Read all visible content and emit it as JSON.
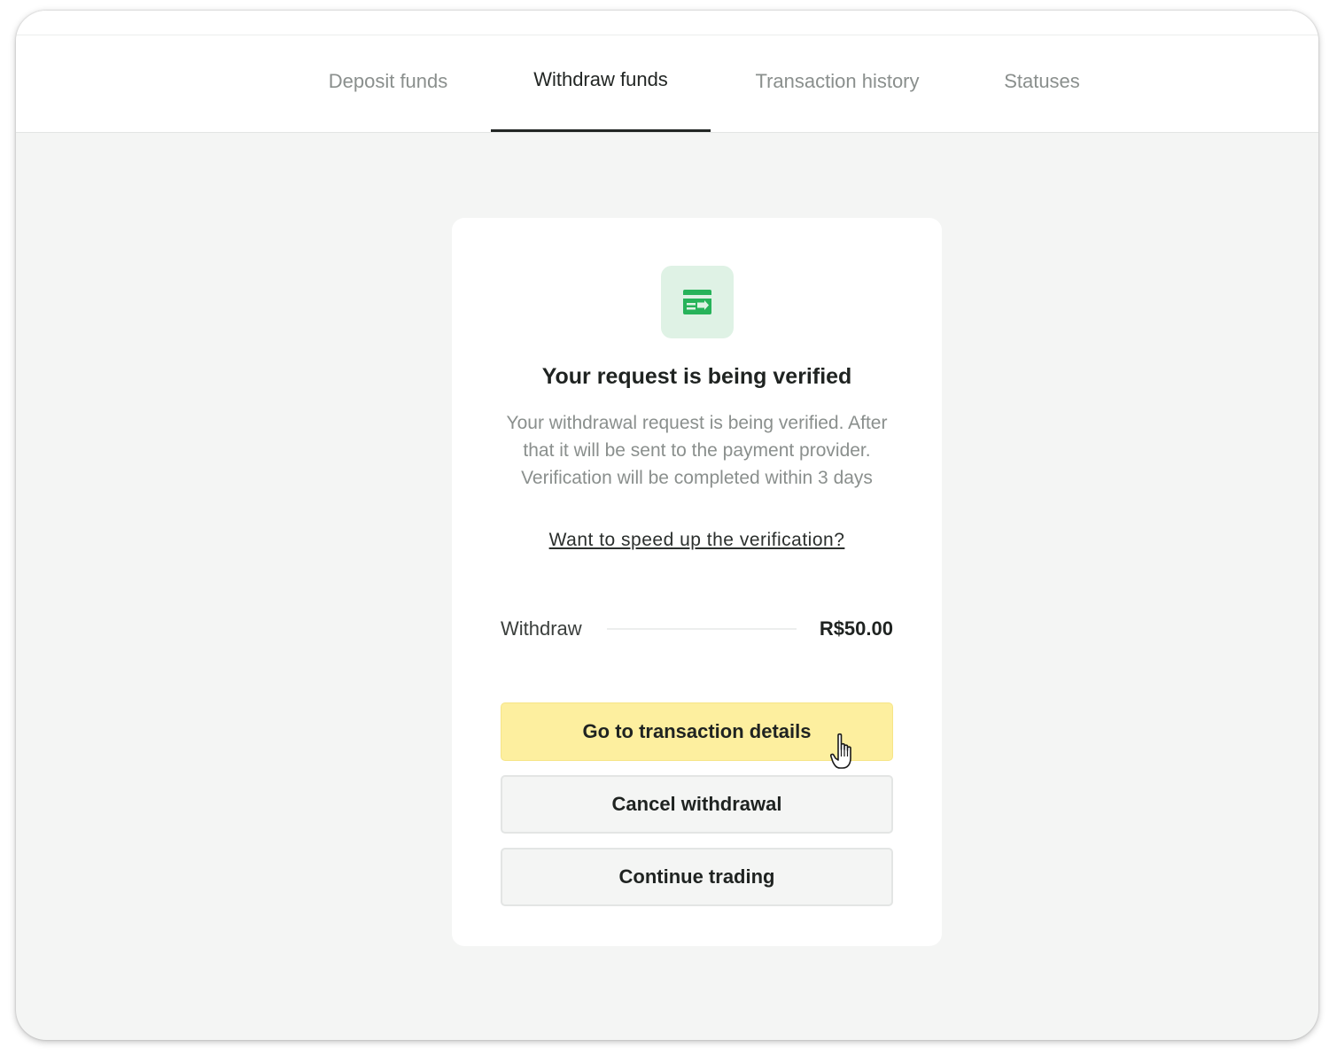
{
  "tabs": [
    {
      "label": "Deposit funds",
      "active": false
    },
    {
      "label": "Withdraw funds",
      "active": true
    },
    {
      "label": "Transaction history",
      "active": false
    },
    {
      "label": "Statuses",
      "active": false
    }
  ],
  "card": {
    "icon": "card-transfer-icon",
    "title": "Your request is being verified",
    "description": "Your withdrawal request is being verified. After that it will be sent to the payment provider. Verification will be completed within 3 days",
    "speed_up_link": "Want to speed up the verification?",
    "withdraw_label": "Withdraw",
    "withdraw_amount": "R$50.00",
    "buttons": {
      "primary": "Go to transaction details",
      "cancel": "Cancel withdrawal",
      "continue": "Continue trading"
    }
  },
  "colors": {
    "primary_button": "#fdef9f",
    "icon_background": "#dff2e5",
    "icon_green": "#27b35a",
    "page_background": "#f4f5f4"
  }
}
